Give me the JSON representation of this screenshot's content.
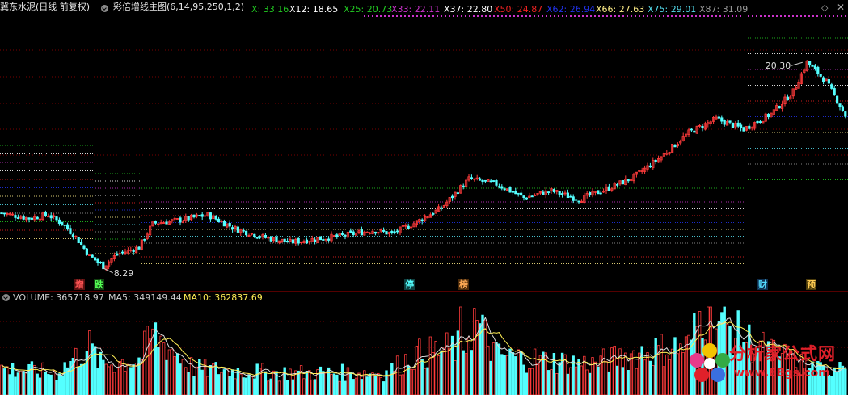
{
  "header": {
    "stock_name": "冀东水泥(日线 前复权)",
    "indicator": "彩倍增线主图(6,14,95,250,1,2)",
    "values": [
      {
        "label": "X:",
        "value": "33.16",
        "color": "#22cc22"
      },
      {
        "label": "X12:",
        "value": "18.65",
        "color": "#ffffff"
      },
      {
        "label": "X25:",
        "value": "20.73",
        "color": "#22cc22"
      },
      {
        "label": "X33:",
        "value": "22.11",
        "color": "#cc33cc"
      },
      {
        "label": "X37:",
        "value": "22.80",
        "color": "#ffffff"
      },
      {
        "label": "X50:",
        "value": "24.87",
        "color": "#ee2222"
      },
      {
        "label": "X62:",
        "value": "26.94",
        "color": "#2233ee"
      },
      {
        "label": "X66:",
        "value": "27.63",
        "color": "#ffee88"
      },
      {
        "label": "X75:",
        "value": "29.01",
        "color": "#55ddee"
      },
      {
        "label": "X87:",
        "value": "31.09",
        "color": "#999999"
      }
    ]
  },
  "volume_header": {
    "values": [
      {
        "label": "VOLUME:",
        "value": "365718.97",
        "color": "#cccccc"
      },
      {
        "label": "MA5:",
        "value": "349149.44",
        "color": "#cccccc"
      },
      {
        "label": "MA10:",
        "value": "362837.69",
        "color": "#ffee55"
      }
    ]
  },
  "annotations": {
    "high_label": "20.30",
    "low_label": "8.29"
  },
  "events": [
    {
      "label": "增",
      "color": "#ff5555",
      "bg": "#5a1010"
    },
    {
      "label": "跌",
      "color": "#55ff55",
      "bg": "#0f3f0f"
    },
    {
      "label": "停",
      "color": "#55ffff",
      "bg": "#0f3f3f"
    },
    {
      "label": "榜",
      "color": "#ffaa55",
      "bg": "#4a2a0a"
    },
    {
      "label": "财",
      "color": "#55ddff",
      "bg": "#0f2f4f"
    },
    {
      "label": "预",
      "color": "#ffcc55",
      "bg": "#4a3a0a"
    }
  ],
  "watermark": {
    "text": "分析家公式网",
    "url": "www.88gs.com"
  },
  "chart_data": {
    "type": "candlestick",
    "price_anchors": [
      [
        0,
        11.5
      ],
      [
        10,
        11.2
      ],
      [
        17,
        11.4
      ],
      [
        22,
        10.9
      ],
      [
        27,
        10.1
      ],
      [
        32,
        9.0
      ],
      [
        37,
        8.4
      ],
      [
        42,
        9.1
      ],
      [
        50,
        9.5
      ],
      [
        55,
        10.9
      ],
      [
        65,
        11.1
      ],
      [
        75,
        11.4
      ],
      [
        85,
        10.6
      ],
      [
        95,
        10.1
      ],
      [
        105,
        9.8
      ],
      [
        115,
        10.0
      ],
      [
        125,
        10.2
      ],
      [
        135,
        10.5
      ],
      [
        142,
        10.3
      ],
      [
        150,
        10.9
      ],
      [
        160,
        11.8
      ],
      [
        170,
        13.5
      ],
      [
        180,
        13.2
      ],
      [
        190,
        12.4
      ],
      [
        200,
        12.8
      ],
      [
        210,
        12.3
      ],
      [
        220,
        12.9
      ],
      [
        230,
        13.6
      ],
      [
        240,
        14.8
      ],
      [
        250,
        16.2
      ],
      [
        260,
        17.0
      ],
      [
        270,
        16.4
      ],
      [
        280,
        17.3
      ],
      [
        288,
        18.6
      ],
      [
        293,
        20.3
      ],
      [
        300,
        19.2
      ],
      [
        307,
        17.2
      ]
    ],
    "high": 20.3,
    "low": 8.29,
    "volume_anchors": [
      [
        0,
        0.3
      ],
      [
        20,
        0.25
      ],
      [
        32,
        0.55
      ],
      [
        36,
        0.35
      ],
      [
        50,
        0.4
      ],
      [
        55,
        0.7
      ],
      [
        70,
        0.3
      ],
      [
        100,
        0.25
      ],
      [
        140,
        0.25
      ],
      [
        150,
        0.45
      ],
      [
        168,
        0.55
      ],
      [
        172,
        0.85
      ],
      [
        180,
        0.45
      ],
      [
        195,
        0.4
      ],
      [
        215,
        0.35
      ],
      [
        235,
        0.5
      ],
      [
        250,
        0.55
      ],
      [
        255,
        0.95
      ],
      [
        262,
        0.8
      ],
      [
        275,
        0.55
      ],
      [
        287,
        0.4
      ],
      [
        300,
        0.25
      ],
      [
        307,
        0.45
      ]
    ],
    "volume_spike": [
      [
        167,
        1.0
      ],
      [
        254,
        0.95
      ],
      [
        257,
        1.0
      ]
    ]
  },
  "colors": {
    "up": "#ff3b3b",
    "down": "#54ffff",
    "separator": "#aa0000",
    "gridline": "#7a0000"
  }
}
